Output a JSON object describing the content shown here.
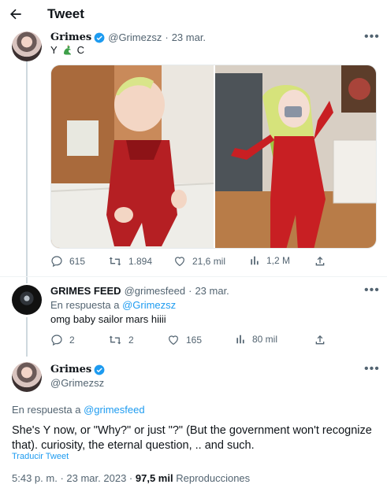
{
  "header": {
    "title": "Tweet"
  },
  "tweet1": {
    "name": "Grimes",
    "handle": "@Grimezsz",
    "time": "23 mar.",
    "text_y": "Y",
    "text_c": "C",
    "actions": {
      "replies": "615",
      "retweets": "1.894",
      "likes": "21,6 mil",
      "views": "1,2 M"
    }
  },
  "tweet2": {
    "name": "GRIMES FEED",
    "handle": "@grimesfeed",
    "time": "23 mar.",
    "reply_prefix": "En respuesta a",
    "reply_to": "@Grimezsz",
    "text": "omg baby sailor mars hiiii",
    "actions": {
      "replies": "2",
      "retweets": "2",
      "likes": "165",
      "views": "80 mil"
    }
  },
  "main_tweet": {
    "name": "Grimes",
    "handle": "@Grimezsz",
    "reply_prefix": "En respuesta a",
    "reply_to": "@grimesfeed",
    "text": "She's Y now, or \"Why?\" or just \"?\" (But the government won't recognize that).  curiosity, the eternal question,  .. and such.",
    "translate": "Traducir Tweet",
    "time": "5:43 p. m.",
    "date": "23 mar. 2023",
    "views_count": "97,5 mil",
    "views_label": "Reproducciones"
  },
  "colors": {
    "accent": "#1d9bf0",
    "muted": "#536471",
    "line": "#cfd9de"
  }
}
